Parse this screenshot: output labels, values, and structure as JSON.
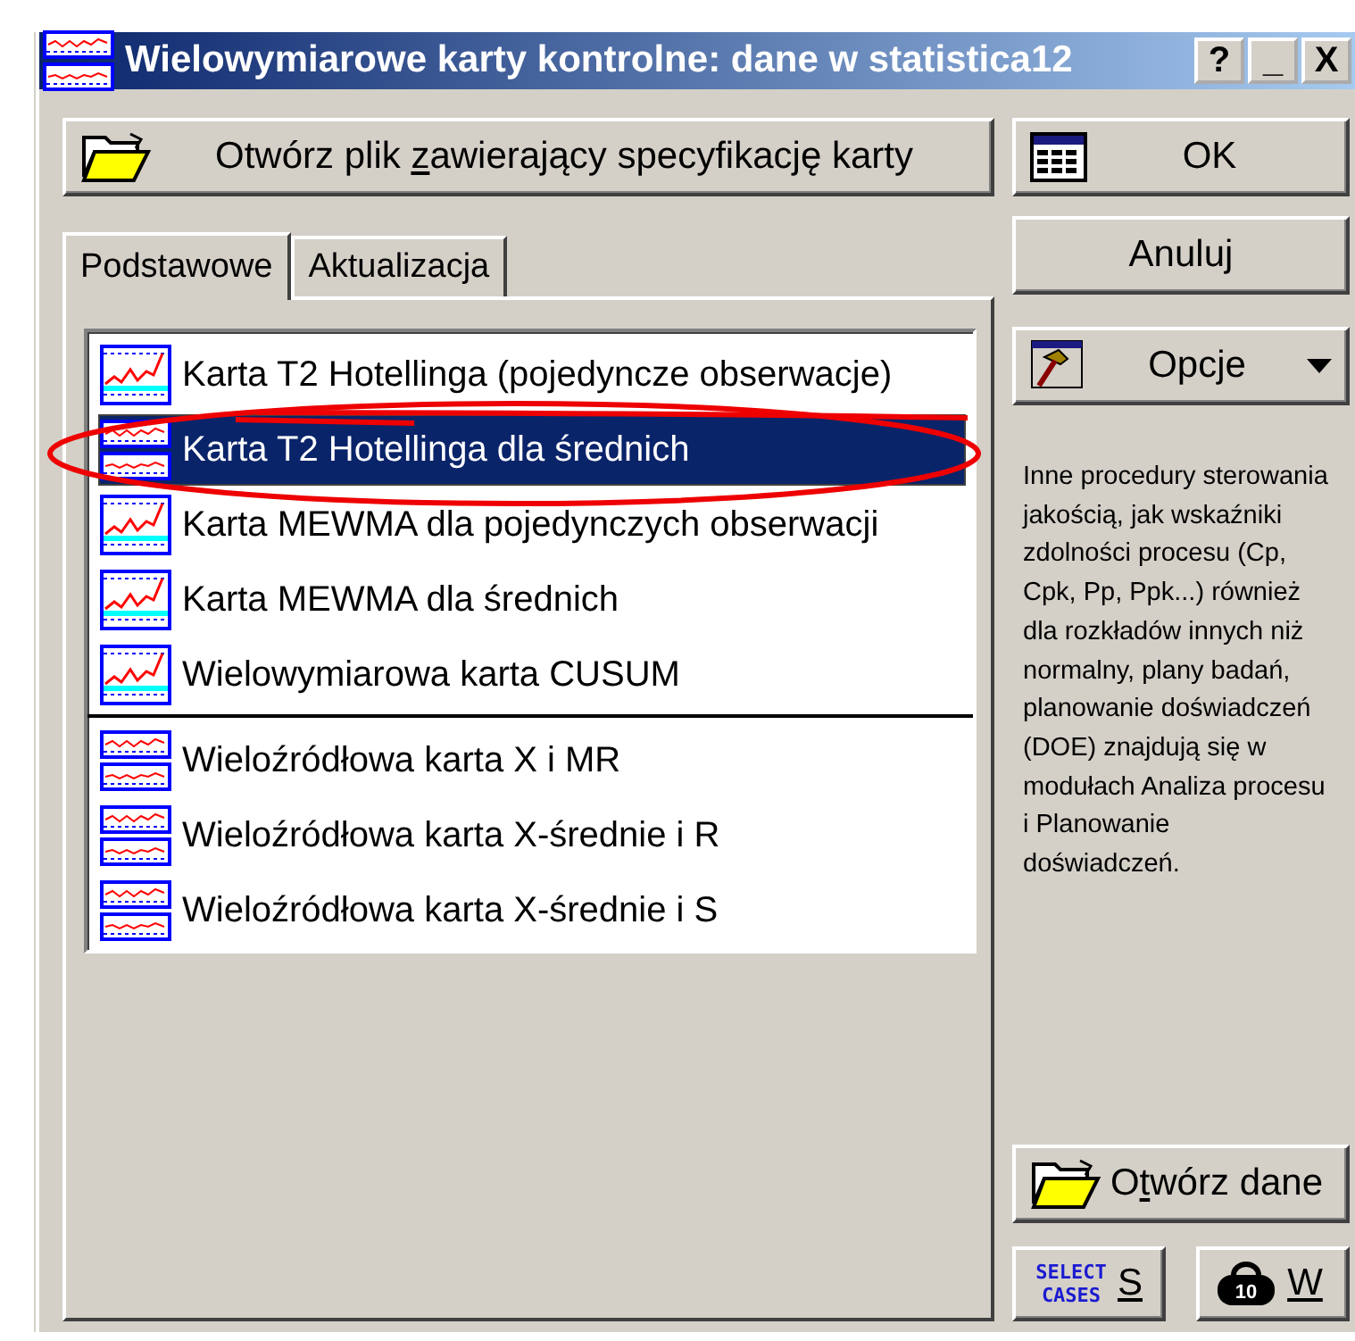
{
  "window": {
    "title": "Wielowymiarowe karty kontrolne: dane w statistica12",
    "controls": [
      {
        "label": "?"
      },
      {
        "label": "_"
      },
      {
        "label": "X"
      }
    ]
  },
  "open_spec_button": {
    "label_parts": [
      "Otwórz plik ",
      "z",
      "awierający specyfikację karty"
    ]
  },
  "tabs": [
    {
      "label": "Podstawowe",
      "selected": true
    },
    {
      "label": "Aktualizacja",
      "selected": false
    }
  ],
  "chart_list": [
    {
      "label": "Karta T2 Hotellinga (pojedyncze obserwacje)",
      "kind": "trend",
      "selected": false
    },
    {
      "label": "Karta T2 Hotellinga dla średnich",
      "kind": "double",
      "selected": true
    },
    {
      "label": "Karta MEWMA dla pojedynczych obserwacji",
      "kind": "trend",
      "selected": false
    },
    {
      "label": "Karta MEWMA dla średnich",
      "kind": "trend",
      "selected": false
    },
    {
      "label": "Wielowymiarowa karta CUSUM",
      "kind": "trend",
      "selected": false
    },
    {
      "kind": "separator"
    },
    {
      "label": "Wieloźródłowa karta X i MR",
      "kind": "double",
      "selected": false
    },
    {
      "label": "Wieloźródłowa karta X-średnie i R",
      "kind": "double",
      "selected": false
    },
    {
      "label": "Wieloźródłowa karta X-średnie i S",
      "kind": "double",
      "selected": false
    }
  ],
  "ok_button": {
    "label": "OK"
  },
  "cancel_button": {
    "label": "Anuluj"
  },
  "options_button": {
    "label": "Opcje"
  },
  "info_text": "Inne procedury sterowania jakością, jak wskaźniki zdolności procesu (Cp, Cpk, Pp, Ppk...) również dla rozkładów innych niż normalny, plany badań, planowanie doświadczeń (DOE) znajdują się w modułach Analiza procesu i Planowanie doświadczeń.",
  "open_data_button": {
    "label_parts": [
      "O",
      "t",
      "wórz dane"
    ]
  },
  "select_cases_button": {
    "icon_text": "SELECT CASES",
    "label": "S"
  },
  "weight_button": {
    "icon_text": "10",
    "label": "W"
  }
}
